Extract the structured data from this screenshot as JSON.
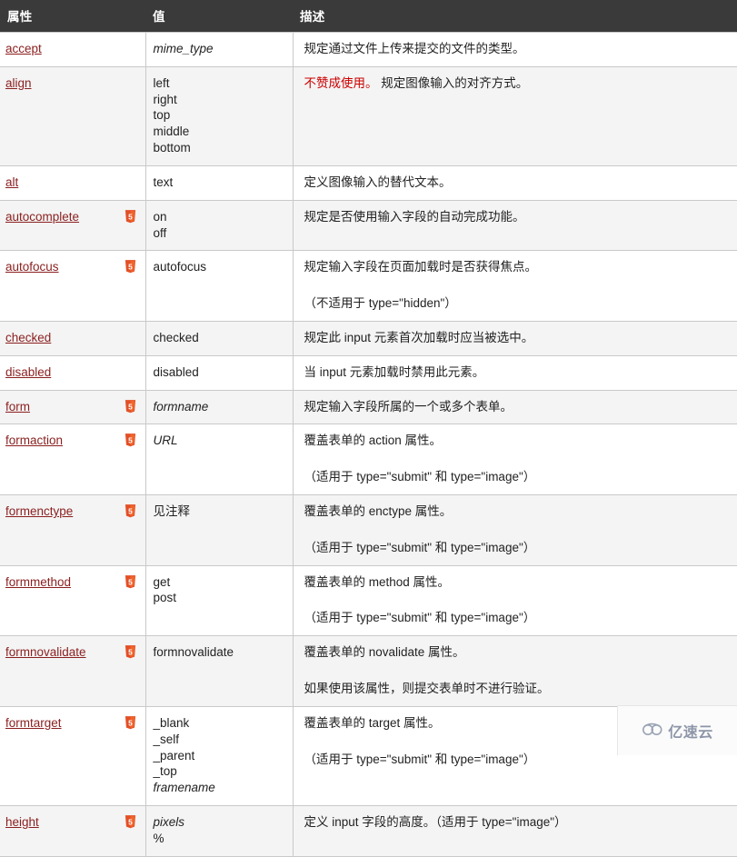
{
  "table": {
    "headers": [
      "属性",
      "值",
      "描述"
    ],
    "rows": [
      {
        "attr": "accept",
        "html5": false,
        "values": [
          "mime_type"
        ],
        "values_italic": [
          true
        ],
        "desc": [
          {
            "deprecated": "",
            "text": "规定通过文件上传来提交的文件的类型。"
          }
        ]
      },
      {
        "attr": "align",
        "html5": false,
        "values": [
          "left",
          "right",
          "top",
          "middle",
          "bottom"
        ],
        "values_italic": [
          false,
          false,
          false,
          false,
          false
        ],
        "desc": [
          {
            "deprecated": "不赞成使用。",
            "text": " 规定图像输入的对齐方式。"
          }
        ]
      },
      {
        "attr": "alt",
        "html5": false,
        "values": [
          "text"
        ],
        "values_italic": [
          false
        ],
        "desc": [
          {
            "deprecated": "",
            "text": "定义图像输入的替代文本。"
          }
        ]
      },
      {
        "attr": "autocomplete",
        "html5": true,
        "values": [
          "on",
          "off"
        ],
        "values_italic": [
          false,
          false
        ],
        "desc": [
          {
            "deprecated": "",
            "text": "规定是否使用输入字段的自动完成功能。"
          }
        ]
      },
      {
        "attr": "autofocus",
        "html5": true,
        "values": [
          "autofocus"
        ],
        "values_italic": [
          false
        ],
        "desc": [
          {
            "deprecated": "",
            "text": "规定输入字段在页面加载时是否获得焦点。"
          },
          {
            "deprecated": "",
            "text": "（不适用于 type=\"hidden\"）"
          }
        ]
      },
      {
        "attr": "checked",
        "html5": false,
        "values": [
          "checked"
        ],
        "values_italic": [
          false
        ],
        "desc": [
          {
            "deprecated": "",
            "text": "规定此 input 元素首次加载时应当被选中。"
          }
        ]
      },
      {
        "attr": "disabled",
        "html5": false,
        "values": [
          "disabled"
        ],
        "values_italic": [
          false
        ],
        "desc": [
          {
            "deprecated": "",
            "text": "当 input 元素加载时禁用此元素。"
          }
        ]
      },
      {
        "attr": "form",
        "html5": true,
        "values": [
          "formname"
        ],
        "values_italic": [
          true
        ],
        "desc": [
          {
            "deprecated": "",
            "text": "规定输入字段所属的一个或多个表单。"
          }
        ]
      },
      {
        "attr": "formaction",
        "html5": true,
        "values": [
          "URL"
        ],
        "values_italic": [
          true
        ],
        "desc": [
          {
            "deprecated": "",
            "text": "覆盖表单的 action 属性。"
          },
          {
            "deprecated": "",
            "text": "（适用于 type=\"submit\" 和 type=\"image\"）"
          }
        ]
      },
      {
        "attr": "formenctype",
        "html5": true,
        "values": [
          "见注释"
        ],
        "values_italic": [
          false
        ],
        "desc": [
          {
            "deprecated": "",
            "text": "覆盖表单的 enctype 属性。"
          },
          {
            "deprecated": "",
            "text": "（适用于 type=\"submit\" 和 type=\"image\"）"
          }
        ]
      },
      {
        "attr": "formmethod",
        "html5": true,
        "values": [
          "get",
          "post"
        ],
        "values_italic": [
          false,
          false
        ],
        "desc": [
          {
            "deprecated": "",
            "text": "覆盖表单的 method 属性。"
          },
          {
            "deprecated": "",
            "text": "（适用于 type=\"submit\" 和 type=\"image\"）"
          }
        ]
      },
      {
        "attr": "formnovalidate",
        "html5": true,
        "values": [
          "formnovalidate"
        ],
        "values_italic": [
          false
        ],
        "desc": [
          {
            "deprecated": "",
            "text": "覆盖表单的 novalidate 属性。"
          },
          {
            "deprecated": "",
            "text": "如果使用该属性，则提交表单时不进行验证。"
          }
        ]
      },
      {
        "attr": "formtarget",
        "html5": true,
        "values": [
          "_blank",
          "_self",
          "_parent",
          "_top",
          "framename"
        ],
        "values_italic": [
          false,
          false,
          false,
          false,
          true
        ],
        "desc": [
          {
            "deprecated": "",
            "text": "覆盖表单的 target 属性。"
          },
          {
            "deprecated": "",
            "text": "（适用于 type=\"submit\" 和 type=\"image\"）"
          }
        ]
      },
      {
        "attr": "height",
        "html5": true,
        "values": [
          "pixels",
          "%"
        ],
        "values_italic": [
          true,
          false
        ],
        "desc": [
          {
            "deprecated": "",
            "text": "定义 input 字段的高度。（适用于 type=\"image\"）"
          }
        ]
      }
    ]
  },
  "watermark": {
    "text": "亿速云",
    "icon": "cloud-glasses-icon"
  },
  "colors": {
    "header_bg": "#3a3a3a",
    "header_text": "#ffffff",
    "link": "#8a1f1f",
    "deprecated": "#cc0000",
    "row_alt_bg": "#f4f4f4",
    "border": "#c9c9c9",
    "html5_badge": "#e34f26"
  }
}
